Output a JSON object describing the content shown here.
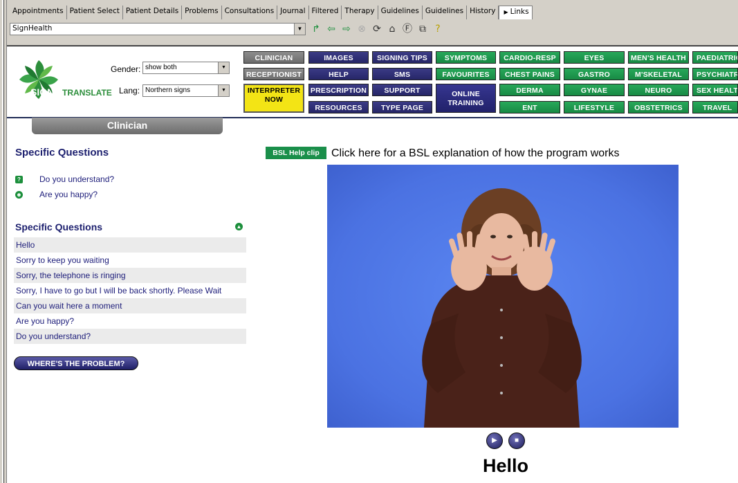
{
  "tabs": [
    {
      "label": "Appointments"
    },
    {
      "label": "Patient Select"
    },
    {
      "label": "Patient Details"
    },
    {
      "label": "Problems"
    },
    {
      "label": "Consultations"
    },
    {
      "label": "Journal"
    },
    {
      "label": "Filtered"
    },
    {
      "label": "Therapy"
    },
    {
      "label": "Guidelines"
    },
    {
      "label": "Guidelines"
    },
    {
      "label": "History"
    },
    {
      "label": "Links",
      "active": true
    }
  ],
  "address": {
    "value": "SignHealth"
  },
  "logo": {
    "sign": "SIGN",
    "translate": "TRANSLATE"
  },
  "filters": {
    "gender_label": "Gender:",
    "gender_value": "show both",
    "lang_label": "Lang:",
    "lang_value": "Northern signs"
  },
  "nav": {
    "clinician": "CLINICIAN",
    "receptionist": "RECEPTIONIST",
    "interpreter_1": "INTERPRETER",
    "interpreter_2": "NOW",
    "images": "IMAGES",
    "help": "HELP",
    "prescription": "PRESCRIPTION",
    "resources": "RESOURCES",
    "signing_tips": "SIGNING TIPS",
    "sms": "SMS",
    "support": "SUPPORT",
    "type_page": "TYPE PAGE",
    "symptoms": "SYMPTOMS",
    "favourites": "FAVOURITES",
    "online_1": "ONLINE",
    "online_2": "TRAINING",
    "cardio": "CARDIO-RESP",
    "chest": "CHEST PAINS",
    "derma": "DERMA",
    "ent": "ENT",
    "eyes": "EYES",
    "gastro": "GASTRO",
    "gynae": "GYNAE",
    "lifestyle": "LIFESTYLE",
    "mens": "MEN'S HEALTH",
    "mskeletal": "M'SKELETAL",
    "neuro": "NEURO",
    "obstetrics": "OBSTETRICS",
    "paediatric": "PAEDIATRIC",
    "psychiatry": "PSYCHIATR",
    "sexhealth": "SEX HEALT",
    "travel": "TRAVEL"
  },
  "section_tab": "Clinician",
  "specific_questions_title": "Specific Questions",
  "quick_questions": [
    {
      "text": "Do you understand?"
    },
    {
      "text": "Are you happy?"
    }
  ],
  "phrases_title": "Specific Questions",
  "phrases": [
    {
      "text": "Hello"
    },
    {
      "text": "Sorry to keep you waiting"
    },
    {
      "text": "Sorry, the telephone is ringing"
    },
    {
      "text": "Sorry, I have to go but I will be back shortly. Please Wait"
    },
    {
      "text": "Can you wait here a moment"
    },
    {
      "text": "Are you happy?"
    },
    {
      "text": "Do you understand?"
    }
  ],
  "problem_button": "WHERE'S THE PROBLEM?",
  "bsl": {
    "badge": "BSL Help clip",
    "text": "Click here for a BSL explanation of how the program works"
  },
  "current_sign": "Hello",
  "colors": {
    "navy": "#262667",
    "green": "#188a44",
    "gray": "#6c6c6c",
    "yellow": "#f3e415",
    "video_bg": "#4b72e2"
  }
}
